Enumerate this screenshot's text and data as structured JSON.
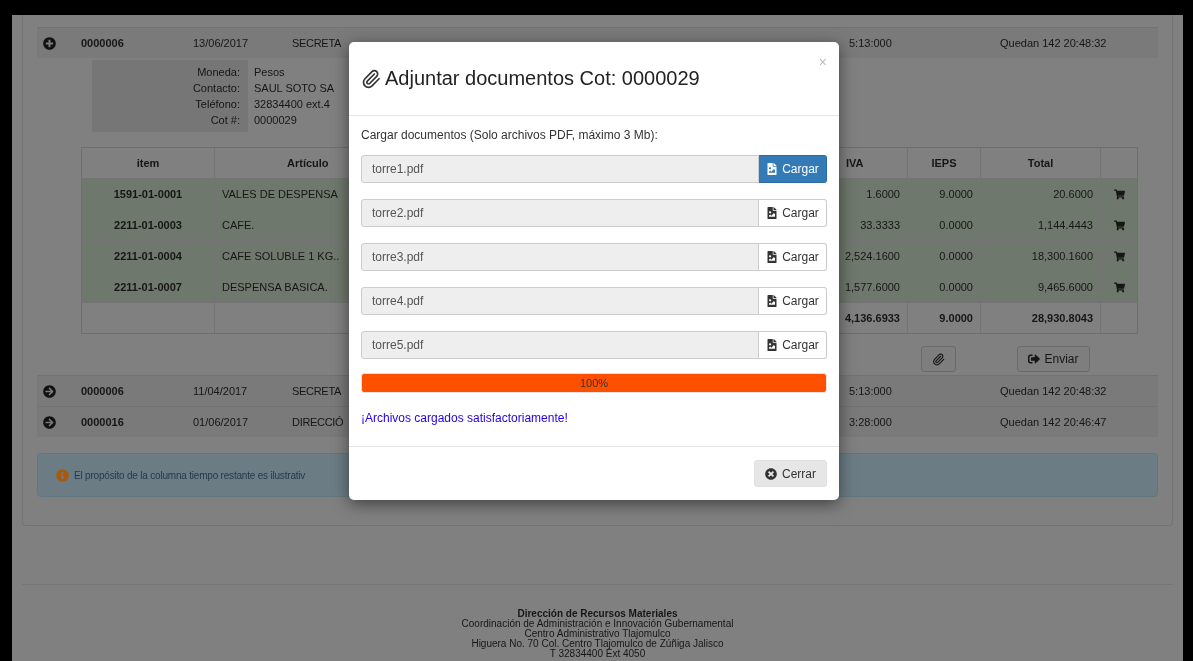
{
  "list_rows": [
    {
      "expanded": true,
      "id": "0000006",
      "date": "13/06/2017",
      "dependency": "SECRETA",
      "term": "5:13:000",
      "remaining": "Quedan 142 20:48:32",
      "details": [
        {
          "label": "Moneda:",
          "value": "Pesos"
        },
        {
          "label": "Contacto:",
          "value": "SAUL SOTO SA"
        },
        {
          "label": "Teléfono:",
          "value": "32834400 ext.4"
        },
        {
          "label": "Cot #:",
          "value": "0000029"
        }
      ],
      "items": {
        "columns": [
          "item",
          "Artículo",
          "IVA",
          "IEPS",
          "Total"
        ],
        "rows": [
          {
            "item": "1591-01-0001",
            "article": "VALES DE DESPENSA",
            "iva": "1.6000",
            "ieps": "9.0000",
            "total": "20.6000"
          },
          {
            "item": "2211-01-0003",
            "article": "CAFE.",
            "iva": "33.3333",
            "ieps": "0.0000",
            "total": "1,144.4443"
          },
          {
            "item": "2211-01-0004",
            "article": "CAFE SOLUBLE 1 KG..",
            "iva": "2,524.1600",
            "ieps": "0.0000",
            "total": "18,300.1600"
          },
          {
            "item": "2211-01-0007",
            "article": "DESPENSA BASICA.",
            "iva": "1,577.6000",
            "ieps": "0.0000",
            "total": "9,465.6000"
          }
        ],
        "totals": {
          "iva": "4,136.6933",
          "ieps": "9.0000",
          "total": "28,930.8043"
        }
      },
      "send_button": "Enviar"
    },
    {
      "expanded": false,
      "id": "0000006",
      "date": "11/04/2017",
      "dependency": "SECRETA",
      "term": "5:13:000",
      "remaining": "Quedan 142 20:48:32"
    },
    {
      "expanded": false,
      "id": "0000016",
      "date": "01/06/2017",
      "dependency": "DIRECCIÓ",
      "term": "3:28:000",
      "remaining": "Quedan 142 20:46:47"
    }
  ],
  "alert": "El propósito de la columna tiempo restante es ilustrativ",
  "footer": {
    "title": "Dirección de Recursos Materiales",
    "lines": [
      "Coordinación de Administración e Innovación Gubernamental",
      "Centro Administrativo Tlajomulco",
      "Higuera No. 70 Col. Centro Tlajomulco de Zúñiga Jalisco",
      "T 32834400 Ext 4050"
    ]
  },
  "modal": {
    "close": "×",
    "title": "Adjuntar documentos Cot: 0000029",
    "instructions": "Cargar documentos (Solo archivos PDF, máximo 3 Mb):",
    "files": [
      {
        "name": "torre1.pdf",
        "button": "Cargar",
        "selected": true
      },
      {
        "name": "torre2.pdf",
        "button": "Cargar",
        "selected": false
      },
      {
        "name": "torre3.pdf",
        "button": "Cargar",
        "selected": false
      },
      {
        "name": "torre4.pdf",
        "button": "Cargar",
        "selected": false
      },
      {
        "name": "torre5.pdf",
        "button": "Cargar",
        "selected": false
      }
    ],
    "progress": {
      "level": 1,
      "label": "100%"
    },
    "success": "¡Archivos cargados satisfactoriamente!",
    "close_button": "Cerrar"
  }
}
